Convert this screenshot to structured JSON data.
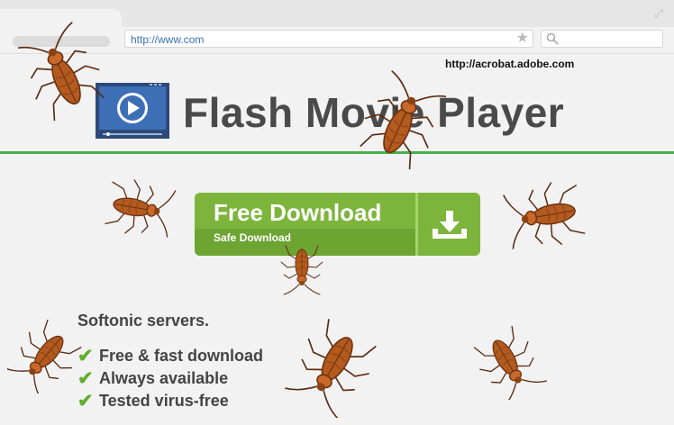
{
  "browser": {
    "address": "http://www.com",
    "icons": [
      "expand-icon",
      "star-icon",
      "search-icon"
    ]
  },
  "overlay_url": "http://acrobat.adobe.com",
  "header": {
    "title": "Flash Movie Player"
  },
  "download_button": {
    "label": "Free Download",
    "sublabel": "Safe Download"
  },
  "features": {
    "heading": "Softonic servers.",
    "items": [
      "Free & fast download",
      "Always available",
      "Tested virus-free"
    ]
  },
  "colors": {
    "accent_green": "#7db53c",
    "rule_green": "#46b04a",
    "roach_body": "#b35a1f"
  }
}
